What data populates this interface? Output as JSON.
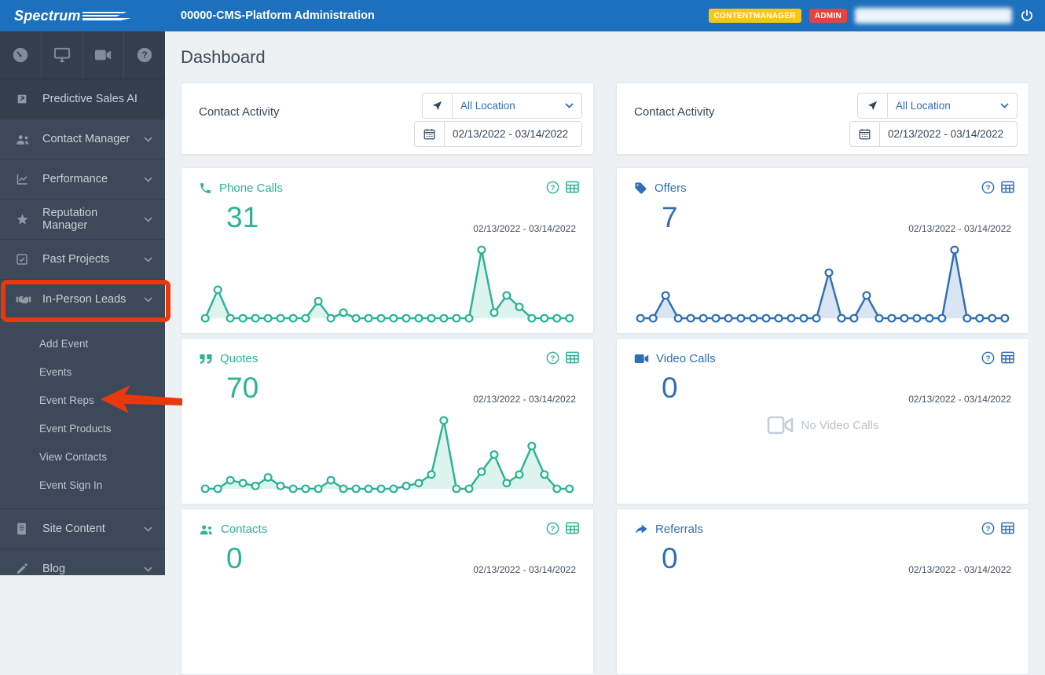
{
  "colors": {
    "header_blue": "#1d70bd",
    "sidebar": "#3b4959",
    "sidebar_dark": "#333f4d",
    "teal": "#2bb394",
    "blue": "#2e6fb6",
    "annotation_red": "#e8380d",
    "page_bg": "#edf1f4"
  },
  "header": {
    "brand": "Spectrum",
    "title": "00000-CMS-Platform Administration",
    "badges": [
      {
        "label": "CONTENTMANAGER",
        "color": "#f7c51b"
      },
      {
        "label": "ADMIN",
        "color": "#e14540"
      }
    ]
  },
  "page": {
    "title": "Dashboard"
  },
  "sidebar": {
    "items": [
      {
        "label": "Predictive Sales AI"
      },
      {
        "label": "Contact Manager"
      },
      {
        "label": "Performance"
      },
      {
        "label": "Reputation Manager"
      },
      {
        "label": "Past Projects"
      },
      {
        "label": "In-Person Leads"
      }
    ],
    "submenu": [
      {
        "label": "Add Event"
      },
      {
        "label": "Events"
      },
      {
        "label": "Event Reps"
      },
      {
        "label": "Event Products"
      },
      {
        "label": "View Contacts"
      },
      {
        "label": "Event Sign In"
      }
    ],
    "items_after": [
      {
        "label": "Site Content"
      },
      {
        "label": "Blog"
      }
    ]
  },
  "panels": [
    {
      "header": {
        "title": "Contact Activity",
        "location": "All Location",
        "date_range": "02/13/2022 - 03/14/2022"
      },
      "cards": [
        {
          "title": "Phone Calls",
          "value": "31",
          "date_range": "02/13/2022 - 03/14/2022"
        },
        {
          "title": "Quotes",
          "value": "70",
          "date_range": "02/13/2022 - 03/14/2022"
        },
        {
          "title": "Contacts",
          "value": "0",
          "date_range": "02/13/2022 - 03/14/2022"
        }
      ]
    },
    {
      "header": {
        "title": "Contact Activity",
        "location": "All Location",
        "date_range": "02/13/2022 - 03/14/2022"
      },
      "cards": [
        {
          "title": "Offers",
          "value": "7",
          "date_range": "02/13/2022 - 03/14/2022"
        },
        {
          "title": "Video Calls",
          "value": "0",
          "date_range": "02/13/2022 - 03/14/2022",
          "empty_text": "No Video Calls"
        },
        {
          "title": "Referrals",
          "value": "0",
          "date_range": "02/13/2022 - 03/14/2022"
        }
      ]
    }
  ],
  "chart_data": [
    {
      "type": "area",
      "title": "Phone Calls",
      "date_range": "02/13/2022 - 03/14/2022",
      "x_unit": "day",
      "legend": "off",
      "grid": "off",
      "color": "#2bb394",
      "fill": "rgba(43,179,148,0.16)",
      "values": [
        0,
        5,
        0,
        0,
        0,
        0,
        0,
        0,
        0,
        3,
        0,
        1,
        0,
        0,
        0,
        0,
        0,
        0,
        0,
        0,
        0,
        0,
        12,
        1,
        4,
        2,
        0,
        0,
        0,
        0
      ]
    },
    {
      "type": "area",
      "title": "Quotes",
      "date_range": "02/13/2022 - 03/14/2022",
      "x_unit": "day",
      "legend": "off",
      "grid": "off",
      "color": "#2bb394",
      "fill": "rgba(43,179,148,0.16)",
      "values": [
        0,
        0,
        1.5,
        1,
        0.5,
        2,
        0.5,
        0,
        0,
        0,
        1.5,
        0,
        0,
        0,
        0,
        0,
        0.5,
        1,
        2.5,
        12,
        0,
        0,
        3,
        6,
        1,
        2.5,
        7.5,
        2.5,
        0,
        0
      ]
    },
    {
      "type": "area",
      "title": "Offers",
      "date_range": "02/13/2022 - 03/14/2022",
      "x_unit": "day",
      "legend": "off",
      "grid": "off",
      "color": "#2e6fb6",
      "fill": "rgba(46,111,182,0.18)",
      "values": [
        0,
        0,
        1,
        0,
        0,
        0,
        0,
        0,
        0,
        0,
        0,
        0,
        0,
        0,
        0,
        2,
        0,
        0,
        1,
        0,
        0,
        0,
        0,
        0,
        0,
        3,
        0,
        0,
        0,
        0
      ]
    }
  ]
}
